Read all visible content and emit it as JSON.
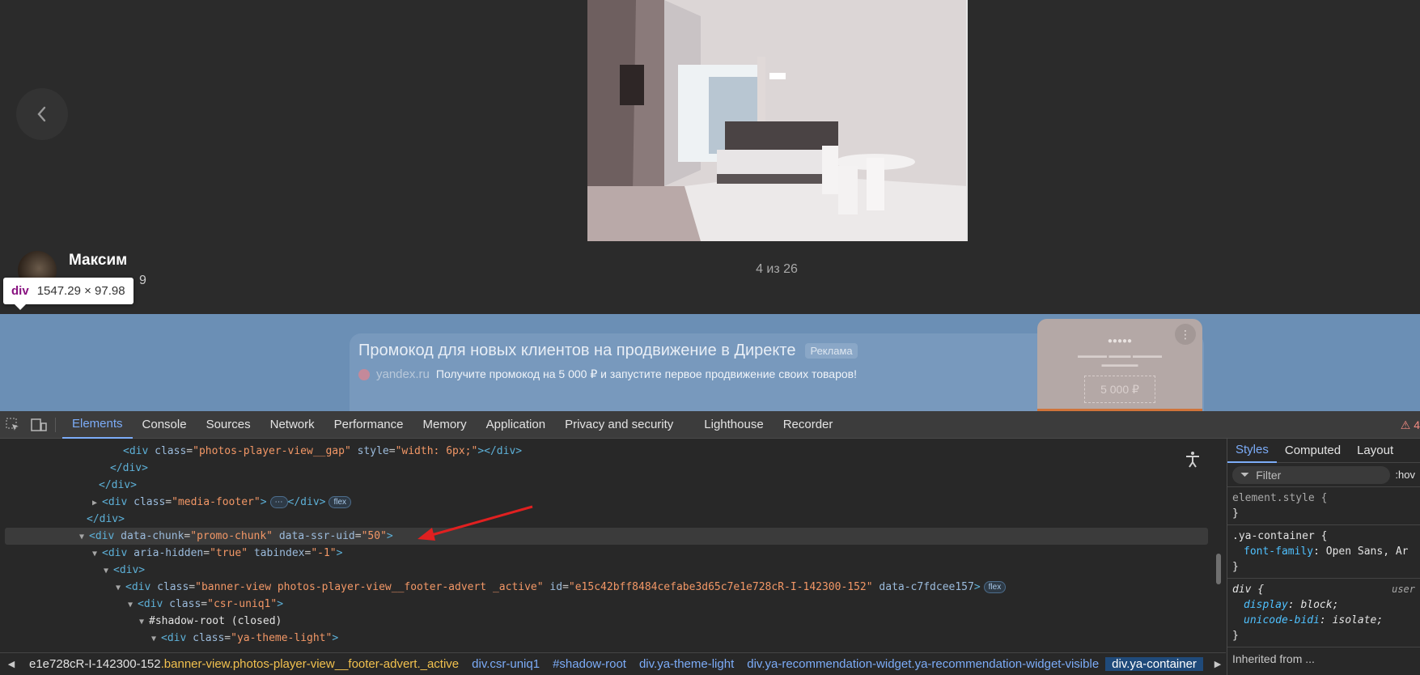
{
  "viewer": {
    "counter": "4 из 26",
    "author_name": "Максим",
    "author_sub": "9"
  },
  "tooltip": {
    "tag": "div",
    "dims": "1547.29 × 97.98"
  },
  "banner": {
    "title": "Промокод для новых клиентов на продвижение в Директе",
    "ad_label": "Реклама",
    "domain": "yandex.ru",
    "description": "Получите промокод на 5 000 ₽ и запустите первое продвижение своих товаров!",
    "card_price": "5 000 ₽"
  },
  "devtools": {
    "tabs": [
      "Elements",
      "Console",
      "Sources",
      "Network",
      "Performance",
      "Memory",
      "Application",
      "Privacy and security",
      "Lighthouse",
      "Recorder"
    ],
    "warning": "⚠ 4",
    "styles_tabs": [
      "Styles",
      "Computed",
      "Layout"
    ],
    "filter_placeholder": "Filter",
    "hov": ":hov",
    "rules": {
      "element_style": "element.style {",
      "close": "}",
      "ya_container_sel": ".ya-container {",
      "ya_container_prop": "font-family",
      "ya_container_val": "Open Sans, Ar",
      "div_sel": "div {",
      "div_ua": "user",
      "div_p1": "display",
      "div_v1": "block;",
      "div_p2": "unicode-bidi",
      "div_v2": "isolate;"
    },
    "inherited": "Inherited from ...",
    "breadcrumbs": [
      {
        "main": "e1e728cR-I-142300-152",
        "cls": ".banner-view.photos-player-view__footer-advert._active"
      },
      {
        "main": "div",
        "cls": ".csr-uniq1"
      },
      {
        "main": "#shadow-root",
        "cls": ""
      },
      {
        "main": "div",
        "cls": ".ya-theme-light"
      },
      {
        "main": "div",
        "cls": ".ya-recommendation-widget.ya-recommendation-widget-visible"
      },
      {
        "main": "div",
        "cls": ".ya-container"
      }
    ]
  },
  "dom": {
    "l1_class": "photos-player-view__gap",
    "l1_style": "width: 6px;",
    "l4_class": "media-footer",
    "l6_chunk": "promo-chunk",
    "l6_uid": "50",
    "l7_hidden": "true",
    "l7_tab": "-1",
    "l9_class": "banner-view photos-player-view__footer-advert _active",
    "l9_id": "e15c42bff8484cefabe3d65c7e1e728cR-I-142300-152",
    "l9_extra": "data-c7fdcee157",
    "l10_class": "csr-uniq1",
    "l11_text": "#shadow-root (closed)",
    "l12_class": "ya-theme-light",
    "flex": "flex",
    "ellipsis": "⋯"
  }
}
